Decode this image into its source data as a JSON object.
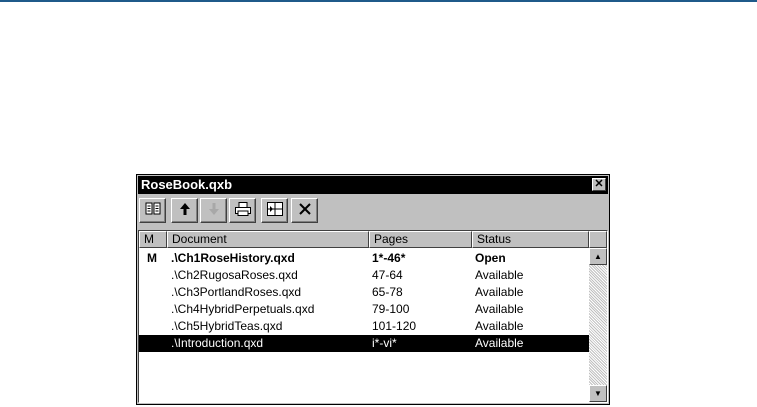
{
  "window": {
    "title": "RoseBook.qxb",
    "close_glyph": "✕"
  },
  "toolbar": {
    "buttons": [
      {
        "name": "add-chapter",
        "glyph": "📖",
        "enabled": true
      },
      {
        "name": "move-up",
        "glyph": "🡅",
        "enabled": true
      },
      {
        "name": "move-down",
        "glyph": "🡇",
        "enabled": false
      },
      {
        "name": "print",
        "glyph": "🖶",
        "enabled": true
      },
      {
        "name": "synchronize",
        "glyph": "⧉",
        "enabled": true
      },
      {
        "name": "remove",
        "glyph": "✕",
        "enabled": true
      }
    ]
  },
  "columns": {
    "m": "M",
    "document": "Document",
    "pages": "Pages",
    "status": "Status"
  },
  "rows": [
    {
      "m": "M",
      "document": ".\\Ch1RoseHistory.qxd",
      "pages": "1*-46*",
      "status": "Open"
    },
    {
      "m": "",
      "document": ".\\Ch2RugosaRoses.qxd",
      "pages": "47-64",
      "status": "Available"
    },
    {
      "m": "",
      "document": ".\\Ch3PortlandRoses.qxd",
      "pages": "65-78",
      "status": "Available"
    },
    {
      "m": "",
      "document": ".\\Ch4HybridPerpetuals.qxd",
      "pages": "79-100",
      "status": "Available"
    },
    {
      "m": "",
      "document": ".\\Ch5HybridTeas.qxd",
      "pages": "101-120",
      "status": "Available"
    },
    {
      "m": "",
      "document": ".\\Introduction.qxd",
      "pages": "i*-vi*",
      "status": "Available"
    }
  ],
  "scrollbar": {
    "up_glyph": "▲",
    "down_glyph": "▼"
  }
}
